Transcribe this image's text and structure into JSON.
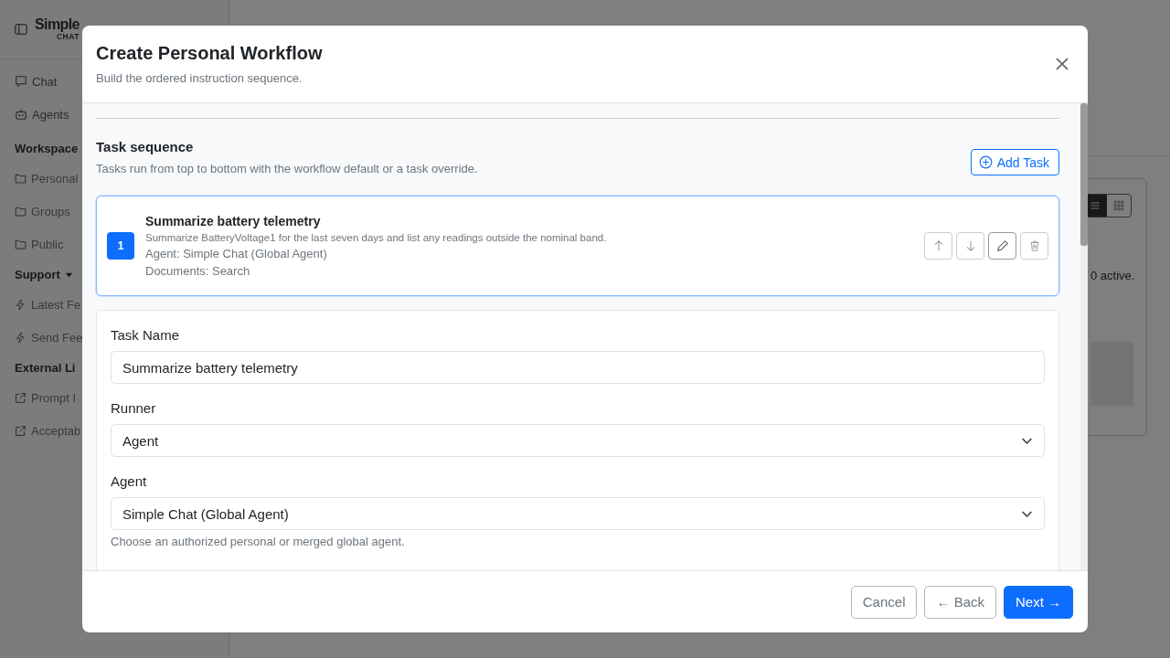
{
  "sidebar": {
    "brand": {
      "name": "Simple",
      "tagline": "CHAT"
    },
    "nav": [
      {
        "label": "Chat"
      },
      {
        "label": "Agents"
      }
    ],
    "sections": [
      {
        "title": "Workspace",
        "items": [
          {
            "label": "Personal"
          },
          {
            "label": "Groups"
          },
          {
            "label": "Public"
          }
        ]
      },
      {
        "title": "Support",
        "expanded": true,
        "items": [
          {
            "label": "Latest Fe"
          },
          {
            "label": "Send Fee"
          }
        ]
      },
      {
        "title": "External Li",
        "items": [
          {
            "label": "Prompt I"
          },
          {
            "label": "Acceptab"
          }
        ]
      }
    ]
  },
  "background_panel": {
    "status": "0 active."
  },
  "dialog": {
    "title": "Create Personal Workflow",
    "subtitle": "Build the ordered instruction sequence.",
    "task_sequence": {
      "title": "Task sequence",
      "description": "Tasks run from top to bottom with the workflow default or a task override.",
      "add_button": "Add Task",
      "tasks": [
        {
          "number": "1",
          "name": "Summarize battery telemetry",
          "instructions": "Summarize BatteryVoltage1 for the last seven days and list any readings outside the nominal band.",
          "agent": "Agent: Simple Chat (Global Agent)",
          "documents": "Documents: Search",
          "selected": true
        }
      ]
    },
    "task_form": {
      "fields": [
        {
          "label": "Task Name",
          "kind": "text",
          "value": "Summarize battery telemetry"
        },
        {
          "label": "Runner",
          "kind": "select",
          "value": "Agent"
        },
        {
          "label": "Agent",
          "kind": "select",
          "value": "Simple Chat (Global Agent)",
          "help": "Choose an authorized personal or merged global agent."
        }
      ]
    },
    "buttons": [
      {
        "label": "Cancel",
        "kind": "secondary"
      },
      {
        "label": "← Back",
        "kind": "secondary"
      },
      {
        "label": "Next →",
        "kind": "primary"
      }
    ]
  }
}
